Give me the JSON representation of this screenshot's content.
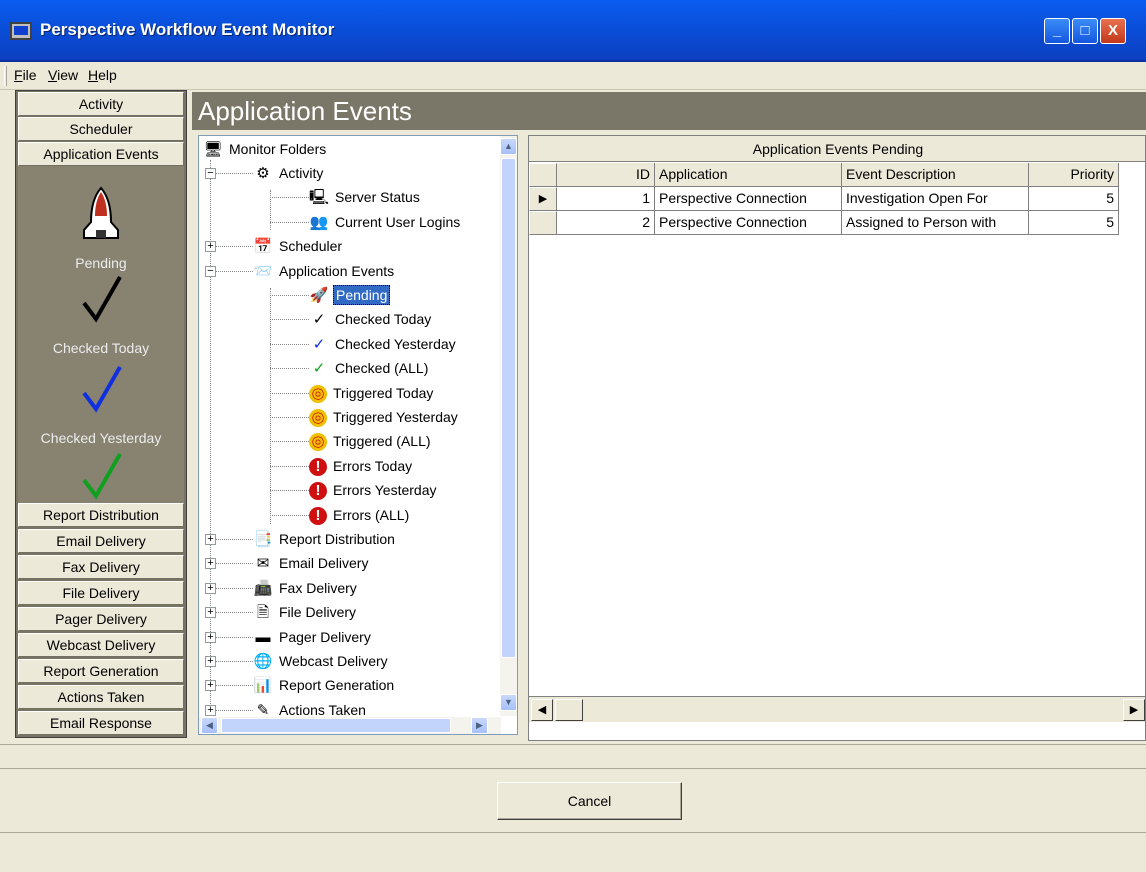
{
  "window": {
    "title": "Perspective Workflow Event Monitor",
    "min_label": "_",
    "max_label": "□",
    "close_label": "X"
  },
  "menu": [
    {
      "label": "File"
    },
    {
      "label": "View"
    },
    {
      "label": "Help"
    }
  ],
  "sidebar": {
    "top_buttons": [
      "Activity",
      "Scheduler",
      "Application Events"
    ],
    "items": [
      {
        "label": "Pending",
        "icon": "shuttle-icon"
      },
      {
        "label": "Checked Today",
        "icon": "check-black-icon"
      },
      {
        "label": "Checked Yesterday",
        "icon": "check-blue-icon"
      },
      {
        "label": "",
        "icon": "check-green-icon"
      }
    ],
    "bottom_buttons": [
      "Report Distribution",
      "Email Delivery",
      "Fax Delivery",
      "File Delivery",
      "Pager Delivery",
      "Webcast Delivery",
      "Report Generation",
      "Actions Taken",
      "Email Response"
    ]
  },
  "header": {
    "title": "Application Events"
  },
  "tree": {
    "root": "Monitor Folders",
    "nodes": [
      {
        "label": "Activity",
        "level": 1,
        "expander": "−",
        "icon": "activity-icon"
      },
      {
        "label": "Server Status",
        "level": 2,
        "icon": "server-icon"
      },
      {
        "label": "Current User Logins",
        "level": 2,
        "icon": "users-icon"
      },
      {
        "label": "Scheduler",
        "level": 1,
        "expander": "+",
        "icon": "scheduler-icon"
      },
      {
        "label": "Application Events",
        "level": 1,
        "expander": "−",
        "icon": "app-events-icon"
      },
      {
        "label": "Pending",
        "level": 2,
        "icon": "shuttle-icon",
        "selected": true
      },
      {
        "label": "Checked Today",
        "level": 2,
        "icon": "check-black-icon"
      },
      {
        "label": "Checked Yesterday",
        "level": 2,
        "icon": "check-blue-icon"
      },
      {
        "label": "Checked (ALL)",
        "level": 2,
        "icon": "check-green-icon"
      },
      {
        "label": "Triggered Today",
        "level": 2,
        "icon": "target-icon"
      },
      {
        "label": "Triggered Yesterday",
        "level": 2,
        "icon": "target-icon"
      },
      {
        "label": "Triggered (ALL)",
        "level": 2,
        "icon": "target-icon"
      },
      {
        "label": "Errors Today",
        "level": 2,
        "icon": "error-icon"
      },
      {
        "label": "Errors Yesterday",
        "level": 2,
        "icon": "error-icon"
      },
      {
        "label": "Errors (ALL)",
        "level": 2,
        "icon": "error-icon"
      },
      {
        "label": "Report Distribution",
        "level": 1,
        "expander": "+",
        "icon": "report-dist-icon"
      },
      {
        "label": "Email Delivery",
        "level": 1,
        "expander": "+",
        "icon": "email-icon"
      },
      {
        "label": "Fax Delivery",
        "level": 1,
        "expander": "+",
        "icon": "fax-icon"
      },
      {
        "label": "File Delivery",
        "level": 1,
        "expander": "+",
        "icon": "file-icon"
      },
      {
        "label": "Pager Delivery",
        "level": 1,
        "expander": "+",
        "icon": "pager-icon"
      },
      {
        "label": "Webcast Delivery",
        "level": 1,
        "expander": "+",
        "icon": "webcast-icon"
      },
      {
        "label": "Report Generation",
        "level": 1,
        "expander": "+",
        "icon": "report-gen-icon"
      },
      {
        "label": "Actions Taken",
        "level": 1,
        "expander": "+",
        "icon": "actions-icon"
      }
    ]
  },
  "grid": {
    "title": "Application Events Pending",
    "columns": [
      "ID",
      "Application",
      "Event Description",
      "Priority"
    ],
    "rows": [
      {
        "id": "1",
        "application": "Perspective Connection",
        "description": "Investigation Open For",
        "priority": "5",
        "current": true
      },
      {
        "id": "2",
        "application": "Perspective Connection",
        "description": "Assigned to Person with",
        "priority": "5",
        "current": false
      }
    ]
  },
  "footer": {
    "cancel_label": "Cancel"
  }
}
